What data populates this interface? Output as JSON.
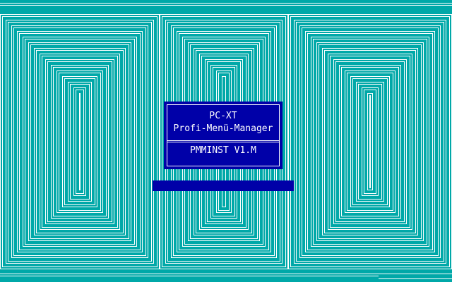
{
  "colors": {
    "background": "#00a8a8",
    "lines": "#ffffff",
    "dialog": "#0000a8",
    "dialog_text": "#ffffff",
    "progress_bar": "#0000a8"
  },
  "splash": {
    "line1": "PC-XT",
    "line2": "Profi-Menü-Manager",
    "version": "PMMINST V1.M"
  },
  "progress": {
    "fraction": 0
  }
}
